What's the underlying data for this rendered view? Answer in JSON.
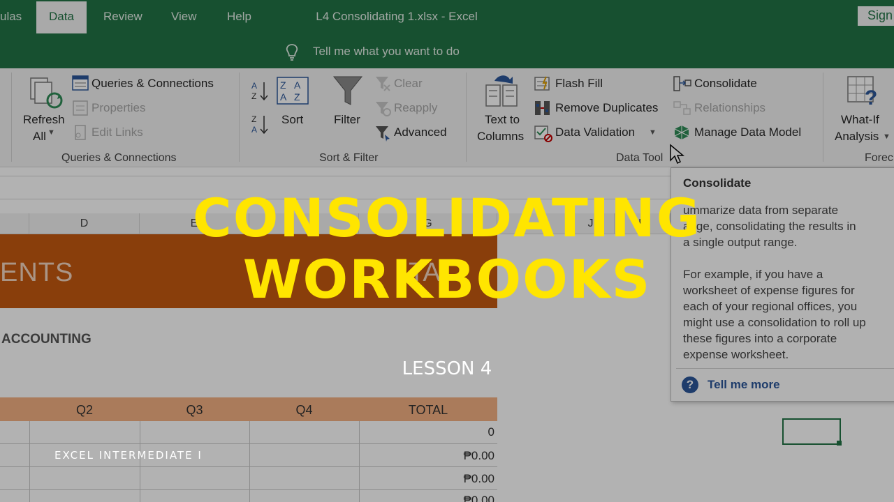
{
  "window": {
    "title": "L4 Consolidating 1.xlsx  -  Excel",
    "signin": "Sign"
  },
  "tabs": [
    "ulas",
    "Data",
    "Review",
    "View",
    "Help"
  ],
  "tell_me": "Tell me what you want to do",
  "ribbon": {
    "refresh_line1": "Refresh",
    "refresh_line2": "All",
    "queries": "Queries & Connections",
    "properties": "Properties",
    "edit_links": "Edit Links",
    "sort": "Sort",
    "filter": "Filter",
    "clear": "Clear",
    "reapply": "Reapply",
    "advanced": "Advanced",
    "text_to_columns_1": "Text to",
    "text_to_columns_2": "Columns",
    "flash_fill": "Flash Fill",
    "remove_duplicates": "Remove Duplicates",
    "data_validation": "Data Validation",
    "consolidate": "Consolidate",
    "relationships": "Relationships",
    "manage_data_model": "Manage Data Model",
    "what_if_1": "What-If",
    "what_if_2": "Analysis",
    "groups": {
      "queries": "Queries & Connections",
      "sort_filter": "Sort & Filter",
      "data_tools": "Data Tool",
      "forecast": "Forec"
    }
  },
  "sheet": {
    "columns": [
      "D",
      "E",
      "G",
      "J",
      "K"
    ],
    "banner_left": "ENTS",
    "banner_right": "TA",
    "accounting": "ACCOUNTING",
    "quarter_headers": [
      "Q2",
      "Q3",
      "Q4",
      "TOTAL"
    ],
    "values": [
      "0",
      "₱0.00",
      "₱0.00",
      "₱0.00"
    ]
  },
  "tooltip": {
    "title": "Consolidate",
    "line1": "ummarize data from separate",
    "line2": "ange, consolidating the results in",
    "line3": "a single output range.",
    "para2_1": "For example, if you have a",
    "para2_2": "worksheet of expense figures for",
    "para2_3": "each of your regional offices, you",
    "para2_4": "might use a consolidation to roll up",
    "para2_5": "these figures into a corporate",
    "para2_6": "expense worksheet.",
    "tell_more": "Tell me more"
  },
  "overlay": {
    "title_line1": "CONSOLIDATING",
    "title_line2": "WORKBOOKS",
    "lesson": "LESSON 4",
    "course": "EXCEL INTERMEDIATE I"
  },
  "colors": {
    "excel_green": "#217346",
    "banner_orange": "#c55a11",
    "title_yellow": "#ffe500"
  }
}
